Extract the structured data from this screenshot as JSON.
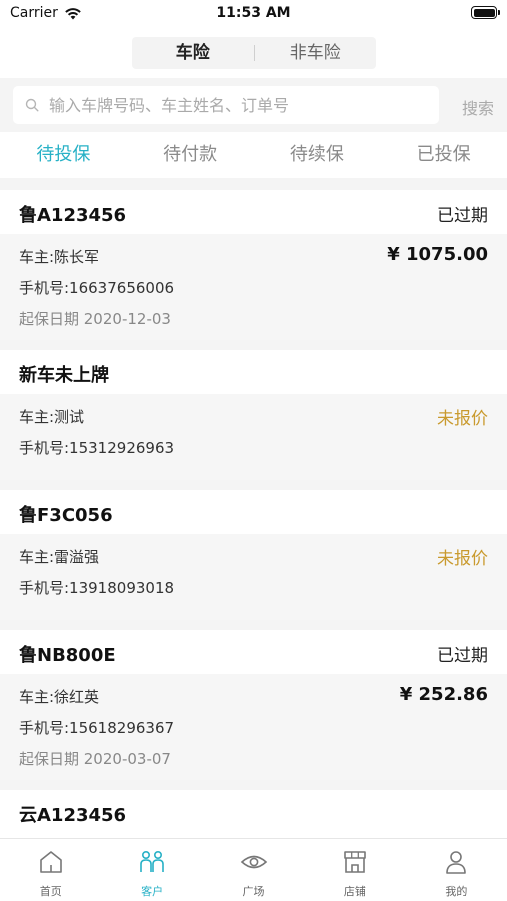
{
  "status_bar": {
    "carrier": "Carrier",
    "time": "11:53 AM"
  },
  "segment": {
    "items": [
      "车险",
      "非车险"
    ],
    "active_index": 0
  },
  "search": {
    "placeholder": "输入车牌号码、车主姓名、订单号",
    "button": "搜索"
  },
  "tabs": {
    "items": [
      "待投保",
      "待付款",
      "待续保",
      "已投保"
    ],
    "active_index": 0
  },
  "orders": [
    {
      "plate": "鲁A123456",
      "status": "已过期",
      "owner": "车主:陈长军",
      "phone": "手机号:16637656006",
      "price": "¥ 1075.00",
      "date": "起保日期 2020-12-03"
    },
    {
      "plate": "新车未上牌",
      "status": "",
      "owner": "车主:测试",
      "phone": "手机号:15312926963",
      "price": "未报价"
    },
    {
      "plate": "鲁F3C056",
      "status": "",
      "owner": "车主:雷溢强",
      "phone": "手机号:13918093018",
      "price": "未报价"
    },
    {
      "plate": "鲁NB800E",
      "status": "已过期",
      "owner": "车主:徐红英",
      "phone": "手机号:15618296367",
      "price": "¥ 252.86",
      "date": "起保日期 2020-03-07"
    },
    {
      "plate": "云A123456",
      "status": ""
    }
  ],
  "colors": {
    "accent": "#27b1c6",
    "pending": "#c99a2e"
  },
  "tabbar": {
    "items": [
      {
        "label": "首页",
        "icon": "home-icon"
      },
      {
        "label": "客户",
        "icon": "customers-icon"
      },
      {
        "label": "广场",
        "icon": "eye-icon"
      },
      {
        "label": "店铺",
        "icon": "store-icon"
      },
      {
        "label": "我的",
        "icon": "profile-icon"
      }
    ],
    "active_index": 1
  }
}
